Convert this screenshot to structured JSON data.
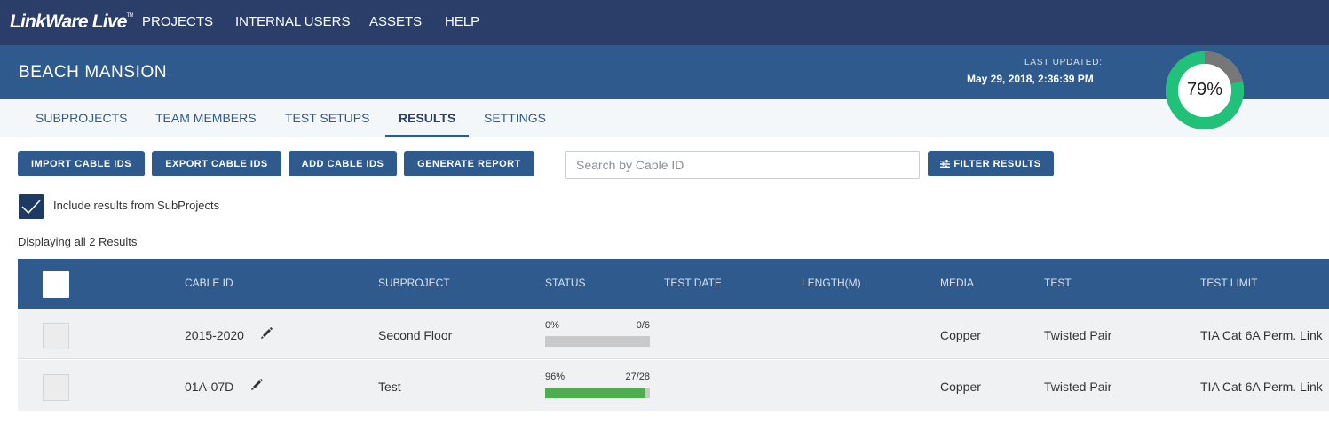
{
  "app": {
    "logo_main": "LinkWare Live",
    "logo_mark": "TM"
  },
  "topnav": {
    "items": [
      "PROJECTS",
      "INTERNAL USERS",
      "ASSETS",
      "HELP"
    ]
  },
  "project": {
    "title": "BEACH MANSION",
    "last_updated_label": "LAST UPDATED:",
    "last_updated_value": "May 29, 2018, 2:36:39 PM",
    "completion_percent": 79,
    "completion_text": "79%"
  },
  "tabs": [
    {
      "label": "SUBPROJECTS",
      "active": false
    },
    {
      "label": "TEAM MEMBERS",
      "active": false
    },
    {
      "label": "TEST SETUPS",
      "active": false
    },
    {
      "label": "RESULTS",
      "active": true
    },
    {
      "label": "SETTINGS",
      "active": false
    }
  ],
  "actions": {
    "import": "IMPORT CABLE IDS",
    "export": "EXPORT CABLE IDS",
    "add": "ADD CABLE IDS",
    "report": "GENERATE REPORT",
    "search_placeholder": "Search by Cable ID",
    "filter": "FILTER RESULTS",
    "filter_icon": "sliders-icon"
  },
  "include_subprojects": {
    "label": "Include results from SubProjects",
    "checked": true
  },
  "results_summary": "Displaying all 2 Results",
  "table": {
    "columns": [
      "CABLE ID",
      "SUBPROJECT",
      "STATUS",
      "TEST DATE",
      "LENGTH(M)",
      "MEDIA",
      "TEST",
      "TEST LIMIT"
    ],
    "rows": [
      {
        "cable_id": "2015-2020",
        "subproject": "Second Floor",
        "status_percent_text": "0%",
        "status_count": "0/6",
        "status_fraction": 0,
        "test_date": "",
        "length": "",
        "media": "Copper",
        "test": "Twisted Pair",
        "test_limit": "TIA Cat 6A Perm. Link"
      },
      {
        "cable_id": "01A-07D",
        "subproject": "Test",
        "status_percent_text": "96%",
        "status_count": "27/28",
        "status_fraction": 0.96,
        "test_date": "",
        "length": "",
        "media": "Copper",
        "test": "Twisted Pair",
        "test_limit": "TIA Cat 6A Perm. Link"
      }
    ]
  },
  "colors": {
    "nav": "#2b3e6a",
    "header": "#2e5a8e",
    "progress_done": "#4cae4c",
    "donut_done": "#22c17a",
    "donut_remaining": "#777777"
  }
}
